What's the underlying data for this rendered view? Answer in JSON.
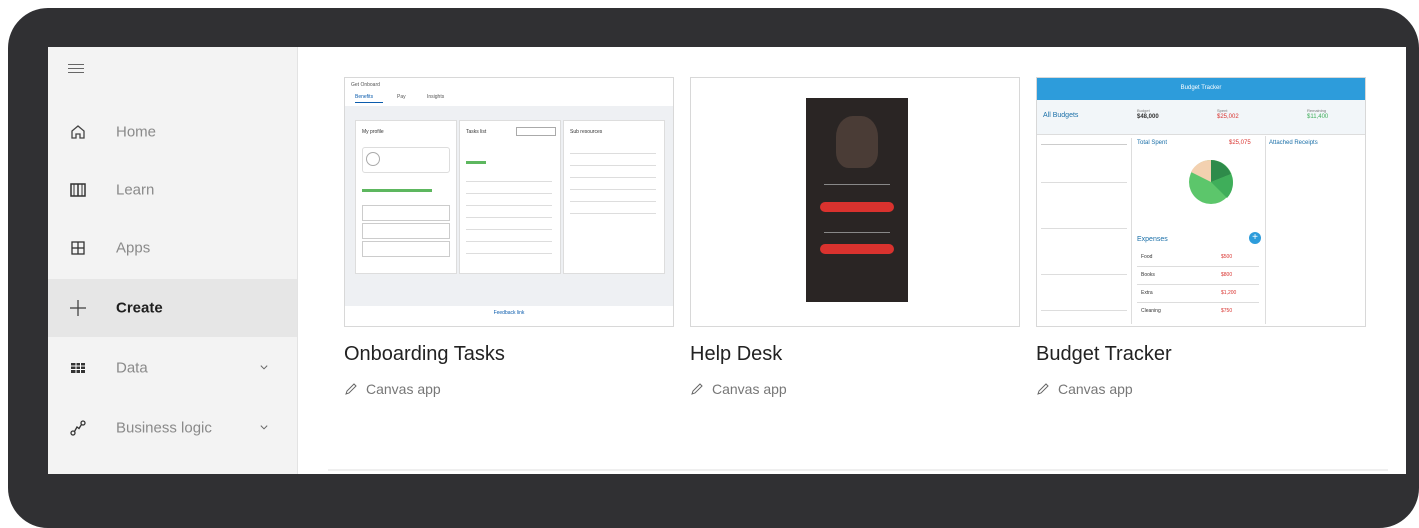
{
  "sidebar": {
    "menu_icon": "hamburger-icon",
    "items": [
      {
        "label": "Home",
        "icon": "home-icon"
      },
      {
        "label": "Learn",
        "icon": "book-icon"
      },
      {
        "label": "Apps",
        "icon": "apps-icon"
      },
      {
        "label": "Create",
        "icon": "plus-icon",
        "active": true
      },
      {
        "label": "Data",
        "icon": "table-icon",
        "expandable": true
      },
      {
        "label": "Business logic",
        "icon": "flow-icon",
        "expandable": true
      }
    ]
  },
  "cards": [
    {
      "title": "Onboarding Tasks",
      "subtitle": "Canvas app",
      "preview": {
        "header": "Get Onboard",
        "tabs": [
          "Benefits",
          "Pay",
          "Insights"
        ],
        "panels": [
          "My profile",
          "Tasks list",
          "Sub resources"
        ],
        "footer": "Feedback link"
      }
    },
    {
      "title": "Help Desk",
      "subtitle": "Canvas app",
      "preview": {}
    },
    {
      "title": "Budget Tracker",
      "subtitle": "Canvas app",
      "preview": {
        "header": "Budget Tracker",
        "left_title": "All Budgets",
        "stats": [
          {
            "label": "Budget",
            "value": "$48,000"
          },
          {
            "label": "Spent",
            "value": "$25,002"
          },
          {
            "label": "Remaining",
            "value": "$11,400"
          }
        ],
        "total_spent_label": "Total Spent",
        "total_spent_value": "$25,075",
        "attached_receipts": "Attached Receipts",
        "expenses_title": "Expenses",
        "expenses": [
          {
            "name": "Food",
            "amount": "$500"
          },
          {
            "name": "Books",
            "amount": "$800"
          },
          {
            "name": "Extra",
            "amount": "$1,200"
          },
          {
            "name": "Cleaning",
            "amount": "$750"
          }
        ]
      }
    }
  ],
  "colors": {
    "frame": "#303033",
    "sidebar_bg": "#f3f3f3",
    "active_bg": "#e6e6e6",
    "budget_blue": "#2d9cdb",
    "helpdesk_red": "#d9322e",
    "pie_green": "#3fae5a"
  }
}
